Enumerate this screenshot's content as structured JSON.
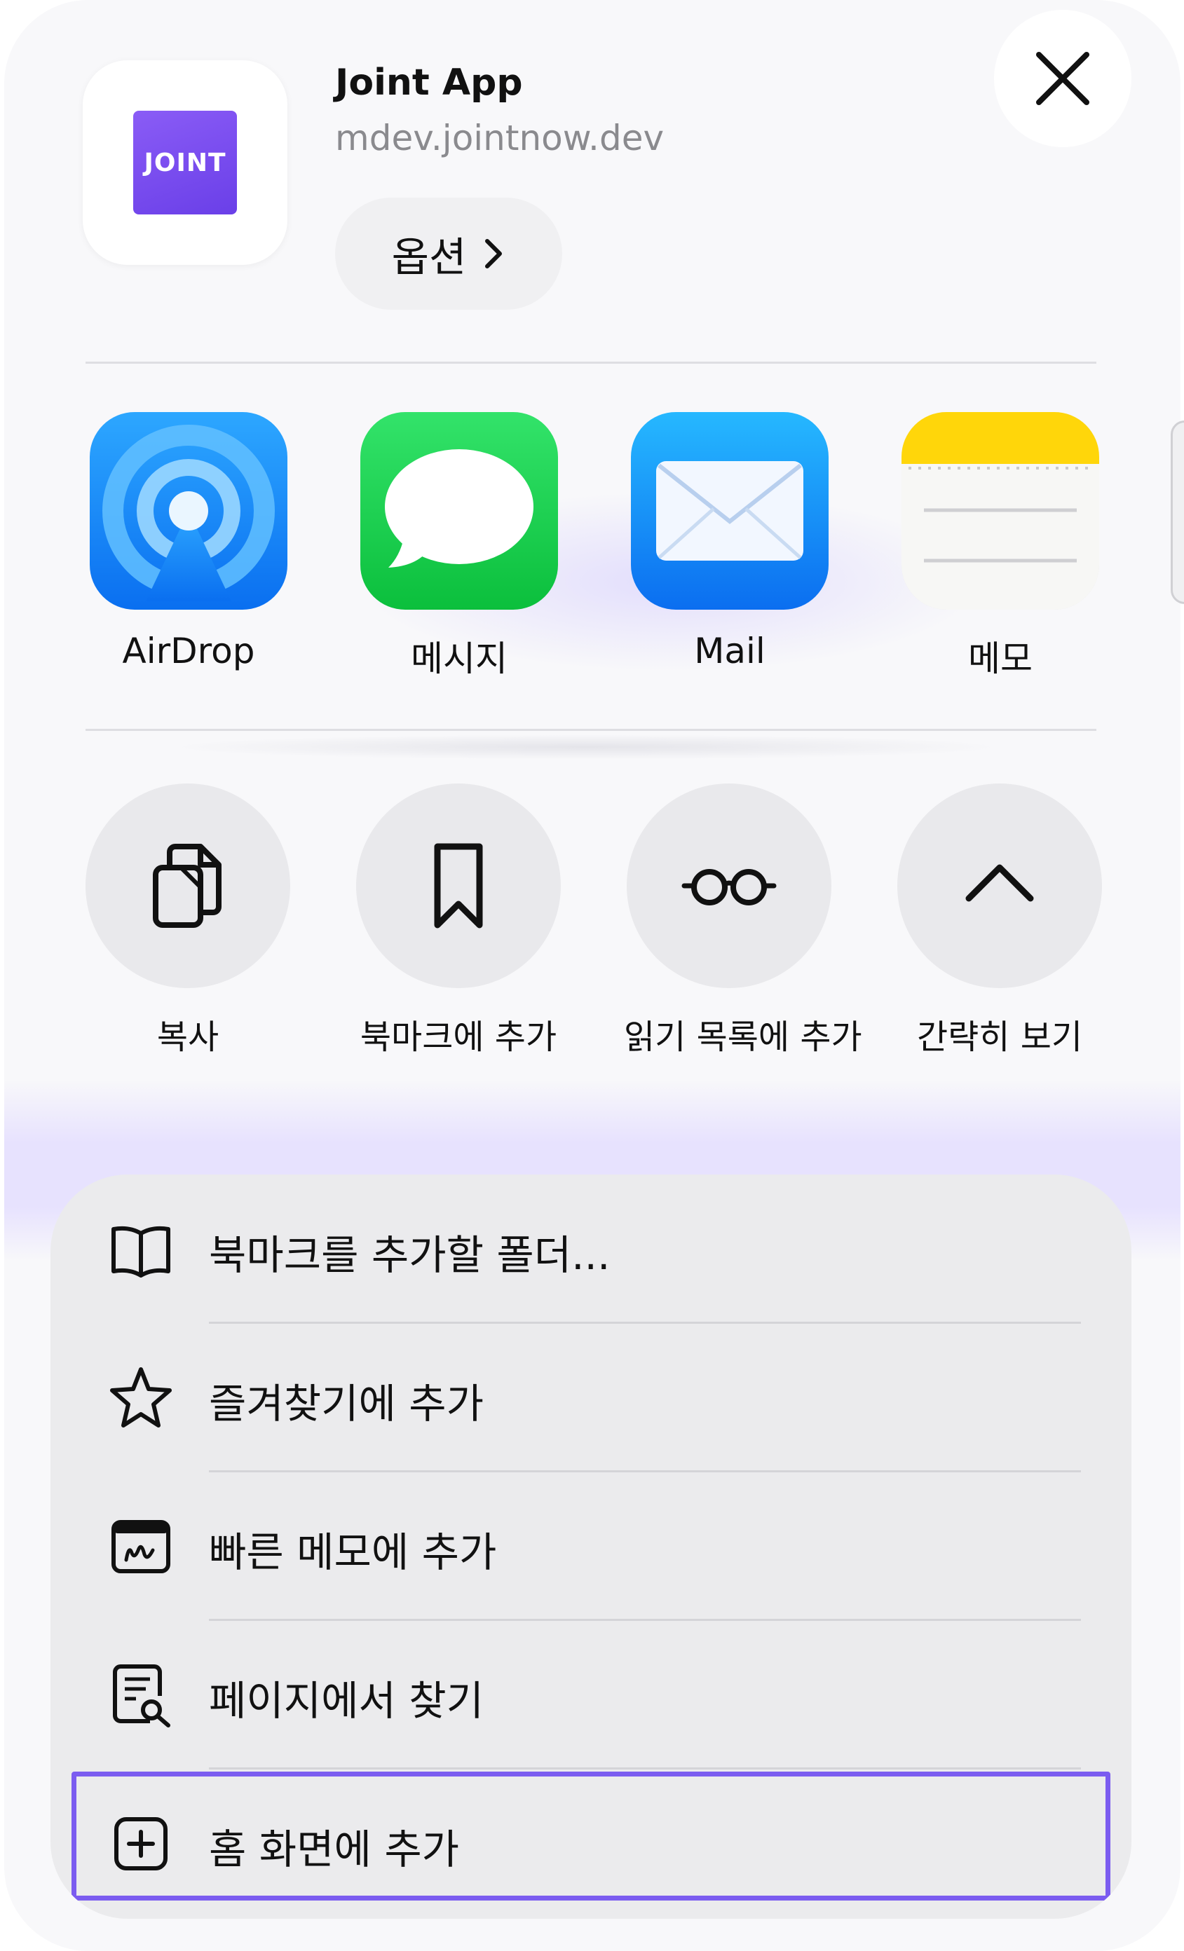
{
  "header": {
    "app_name": "Joint App",
    "app_url": "mdev.jointnow.dev",
    "logo_text": "JOINT",
    "options_label": "옵션",
    "close_icon": "close-icon"
  },
  "apps": [
    {
      "label": "AirDrop",
      "icon": "airdrop-icon"
    },
    {
      "label": "메시지",
      "icon": "messages-icon"
    },
    {
      "label": "Mail",
      "icon": "mail-icon"
    },
    {
      "label": "메모",
      "icon": "notes-icon"
    }
  ],
  "actions": [
    {
      "label": "복사",
      "icon": "copy-icon"
    },
    {
      "label": "북마크에 추가",
      "icon": "bookmark-icon"
    },
    {
      "label": "읽기 목록에 추가",
      "icon": "reading-glasses-icon"
    },
    {
      "label": "간략히 보기",
      "icon": "chevron-up-icon"
    }
  ],
  "menu": [
    {
      "label": "북마크를 추가할 폴더...",
      "icon": "book-icon"
    },
    {
      "label": "즐겨찾기에 추가",
      "icon": "star-icon"
    },
    {
      "label": "빠른 메모에 추가",
      "icon": "quick-note-icon"
    },
    {
      "label": "페이지에서 찾기",
      "icon": "find-in-page-icon"
    },
    {
      "label": "홈 화면에 추가",
      "icon": "add-square-icon",
      "highlighted": true
    }
  ],
  "colors": {
    "highlight_border": "#7b5cf0",
    "logo_purple": "#7a4df0"
  }
}
